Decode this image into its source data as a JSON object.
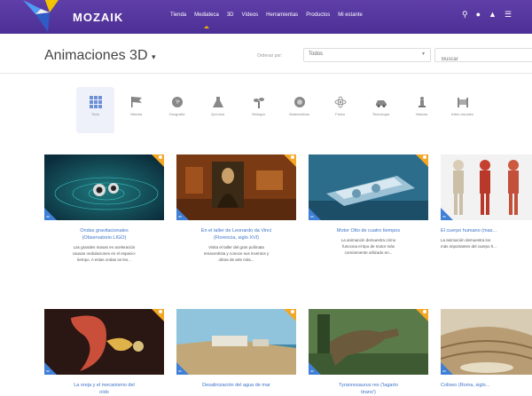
{
  "brand": {
    "name": "MOZAIK"
  },
  "nav": {
    "items": [
      "Tienda",
      "Mediateca",
      "3D",
      "Vídeos",
      "Herramientas",
      "Productos",
      "Mi estante"
    ]
  },
  "header": {
    "title": "Animaciones 3D",
    "title_caret": "▾",
    "order_label": "Ordenar por:",
    "filter_value": "Todos",
    "filter_caret": "▾",
    "search_placeholder": "Buscar"
  },
  "categories": [
    {
      "label": "Todo",
      "icon": "grid-icon"
    },
    {
      "label": "Historia",
      "icon": "flag-icon"
    },
    {
      "label": "Geografía",
      "icon": "globe-icon"
    },
    {
      "label": "Química",
      "icon": "flask-icon"
    },
    {
      "label": "Biología",
      "icon": "plant-icon"
    },
    {
      "label": "Matemáticas",
      "icon": "shapes-icon"
    },
    {
      "label": "Física",
      "icon": "atom-icon"
    },
    {
      "label": "Tecnología",
      "icon": "car-icon"
    },
    {
      "label": "Historia",
      "icon": "statue-icon"
    },
    {
      "label": "Artes visuales",
      "icon": "easel-icon"
    }
  ],
  "cards": [
    {
      "title_line1": "Ondas gravitacionales",
      "title_line2": "(Observatorio LIGO)",
      "desc_line1": "Las grandes masas en aceleración",
      "desc_line2": "causan ondulaciones en el espacio-",
      "desc_line3": "tiempo. A estas ondas se les...",
      "badge": "3D"
    },
    {
      "title_line1": "En el taller de Leonardo da Vinci",
      "title_line2": "(Florencia, siglo XVI)",
      "desc_line1": "Visita el taller del gran polímata",
      "desc_line2": "renacentista y conoce sus inventos y",
      "desc_line3": "obras de arte más...",
      "badge": "3D"
    },
    {
      "title_line1": "Motor Otto de cuatro tiempos",
      "title_line2": "",
      "desc_line1": "La animación demuestra cómo",
      "desc_line2": "funciona el tipo de motor más",
      "desc_line3": "comúnmente utilizado en...",
      "badge": "3D"
    },
    {
      "title_line1": "El cuerpo humano (mas...",
      "title_line2": "",
      "desc_line1": "La animación demuestra los",
      "desc_line2": "más importantes del cuerpo h...",
      "desc_line3": "",
      "badge": "3D"
    },
    {
      "title_line1": "La oreja y el mecanismo del",
      "title_line2": "oído",
      "desc_line1": "",
      "desc_line2": "",
      "desc_line3": "",
      "badge": "3D"
    },
    {
      "title_line1": "Desalinización del agua de mar",
      "title_line2": "",
      "desc_line1": "",
      "desc_line2": "",
      "desc_line3": "",
      "badge": "3D"
    },
    {
      "title_line1": "Tyrannosaurus rex ('lagarto",
      "title_line2": "tirano')",
      "desc_line1": "",
      "desc_line2": "",
      "desc_line3": "",
      "badge": "3D"
    },
    {
      "title_line1": "Coliseo (Roma, siglo...",
      "title_line2": "",
      "desc_line1": "",
      "desc_line2": "",
      "desc_line3": "",
      "badge": "3D"
    }
  ],
  "colors": {
    "nav_bg": "#5640a0",
    "accent_orange": "#f5a623",
    "link_blue": "#3d73c8",
    "badge_blue": "#3f7fd6"
  }
}
